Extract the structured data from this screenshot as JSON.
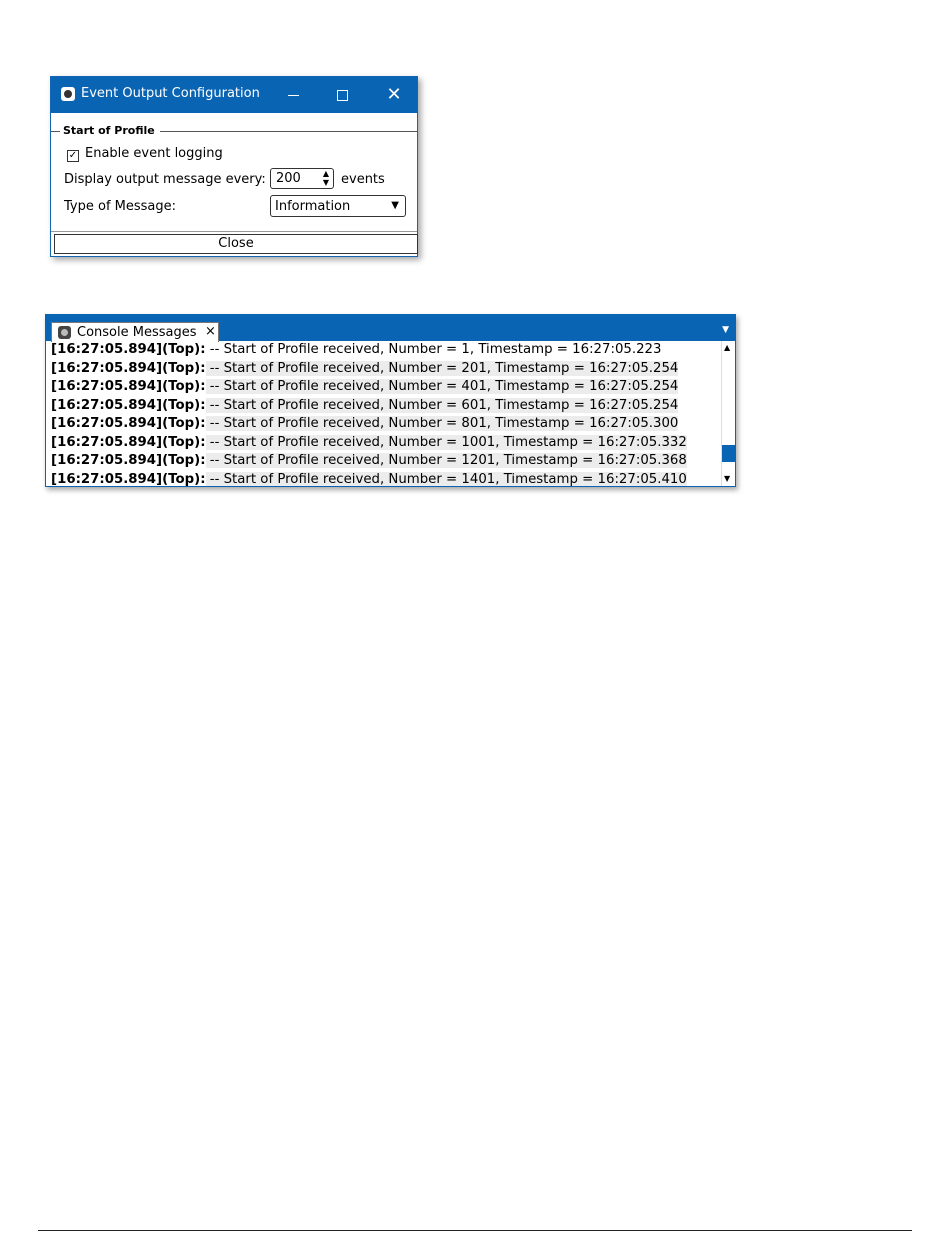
{
  "dialog": {
    "title": "Event Output Configuration",
    "min_glyph": "—",
    "max_glyph": "☐",
    "close_glyph": "✕",
    "group_title": "Start of Profile",
    "enable_logging_label": "Enable event logging",
    "enable_logging_checked": true,
    "check_glyph": "✓",
    "display_label": "Display output message every:",
    "display_value": "200",
    "events_label": "events",
    "type_label": "Type of Message:",
    "type_value": "Information",
    "close_label": "Close"
  },
  "console": {
    "tab_label": "Console Messages",
    "tab_close_glyph": "×",
    "dropdown_glyph": "▼",
    "rows": [
      {
        "prefix": "[16:27:05.894](Top):",
        "message": " -- Start of Profile received, Number = 1, Timestamp = 16:27:05.223"
      },
      {
        "prefix": "[16:27:05.894](Top):",
        "message": " -- Start of Profile received, Number = 201, Timestamp = 16:27:05.254"
      },
      {
        "prefix": "[16:27:05.894](Top):",
        "message": " -- Start of Profile received, Number = 401, Timestamp = 16:27:05.254"
      },
      {
        "prefix": "[16:27:05.894](Top):",
        "message": " -- Start of Profile received, Number = 601, Timestamp = 16:27:05.254"
      },
      {
        "prefix": "[16:27:05.894](Top):",
        "message": " -- Start of Profile received, Number = 801, Timestamp = 16:27:05.300"
      },
      {
        "prefix": "[16:27:05.894](Top):",
        "message": " -- Start of Profile received, Number = 1001, Timestamp = 16:27:05.332"
      },
      {
        "prefix": "[16:27:05.894](Top):",
        "message": " -- Start of Profile received, Number = 1201, Timestamp = 16:27:05.368"
      },
      {
        "prefix": "[16:27:05.894](Top):",
        "message": " -- Start of Profile received, Number = 1401, Timestamp = 16:27:05.410"
      }
    ]
  },
  "colors": {
    "accent": "#0a64b4",
    "row_highlight": "#ececec"
  }
}
